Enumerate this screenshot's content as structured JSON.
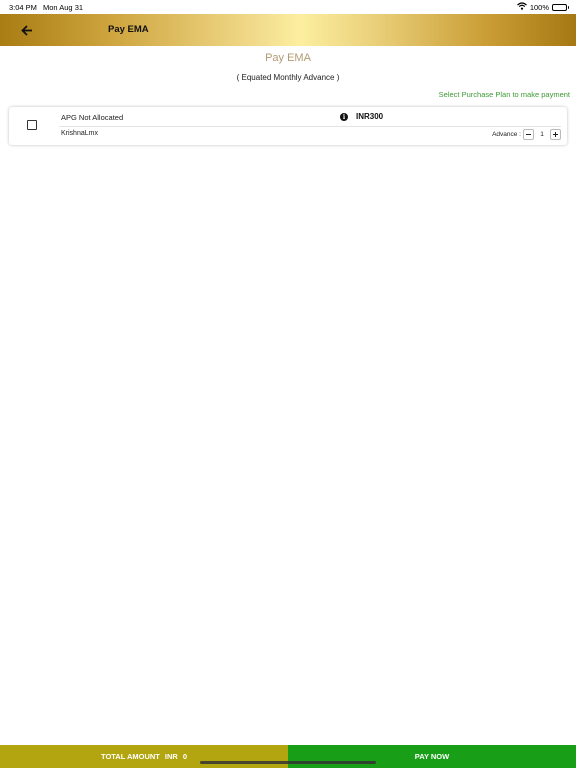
{
  "status_bar": {
    "time": "3:04 PM",
    "date": "Mon Aug 31",
    "battery_text": "100%",
    "battery_level": 1.0,
    "wifi_icon": "wifi-icon"
  },
  "header": {
    "title": "Pay EMA",
    "back_icon": "arrow-left-icon"
  },
  "page": {
    "title": "Pay EMA",
    "subtitle": "( Equated Monthly Advance )",
    "hint": "Select Purchase Plan to make payment"
  },
  "plans": [
    {
      "label": "APG Not Allocated",
      "amount": "INR300",
      "name": "KrishnaLmx",
      "advance_label": "Advance :",
      "advance_value": "1",
      "checked": false
    }
  ],
  "footer": {
    "total_label": "TOTAL AMOUNT",
    "currency": "INR",
    "total_value": "0",
    "pay_label": "PAY NOW"
  },
  "colors": {
    "total_bg": "#b3a510",
    "pay_bg": "#199e17",
    "hint_text": "#3b9a33",
    "title_text": "#b39a72"
  }
}
